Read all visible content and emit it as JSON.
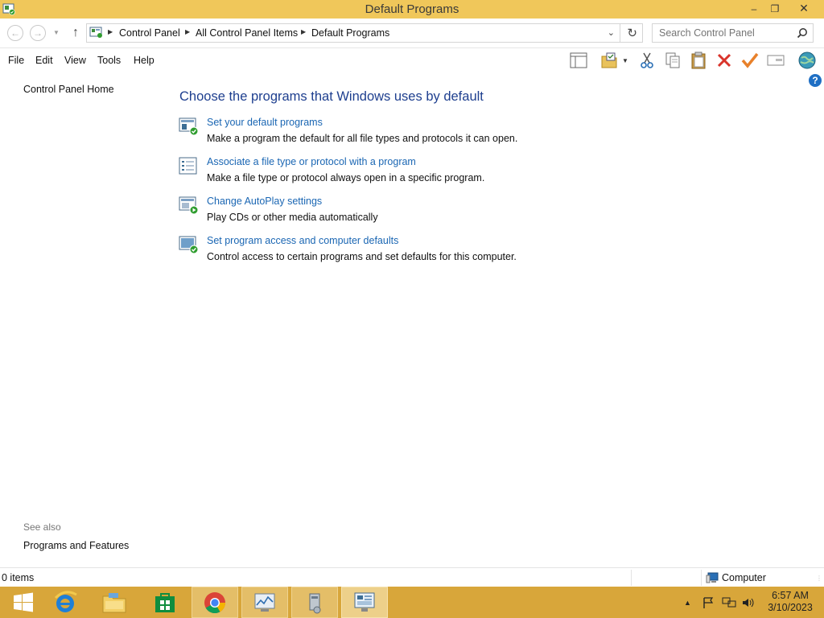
{
  "window": {
    "title": "Default Programs",
    "minimize": "–",
    "restore": "❐",
    "close": "✕"
  },
  "address_bar": {
    "breadcrumbs": [
      "Control Panel",
      "All Control Panel Items",
      "Default Programs"
    ],
    "search_placeholder": "Search Control Panel"
  },
  "menu": [
    "File",
    "Edit",
    "View",
    "Tools",
    "Help"
  ],
  "toolbar": [
    "layout-icon",
    "folder-options-icon",
    "cut-icon",
    "copy-icon",
    "paste-icon",
    "delete-icon",
    "checkmark-icon",
    "properties-icon",
    "globe-icon"
  ],
  "left_pane": {
    "home_link": "Control Panel Home",
    "see_also_label": "See also",
    "see_also_links": [
      "Programs and Features"
    ]
  },
  "main": {
    "heading": "Choose the programs that Windows uses by default",
    "tasks": [
      {
        "icon": "default-programs-icon",
        "link": "Set your default programs",
        "description": "Make a program the default for all file types and protocols it can open."
      },
      {
        "icon": "file-association-icon",
        "link": "Associate a file type or protocol with a program",
        "description": "Make a file type or protocol always open in a specific program."
      },
      {
        "icon": "autoplay-icon",
        "link": "Change AutoPlay settings",
        "description": "Play CDs or other media automatically"
      },
      {
        "icon": "program-access-icon",
        "link": "Set program access and computer defaults",
        "description": "Control access to certain programs and set defaults for this computer."
      }
    ]
  },
  "status_bar": {
    "items_count": "0 items",
    "location": "Computer"
  },
  "taskbar": {
    "apps": [
      "start-button",
      "internet-explorer-icon",
      "file-explorer-icon",
      "store-icon",
      "chrome-icon",
      "performance-monitor-icon",
      "system-tool-icon",
      "control-panel-icon"
    ],
    "clock_time": "6:57 AM",
    "clock_date": "3/10/2023"
  },
  "colors": {
    "title_bar": "#f0c75a",
    "taskbar": "#d8a63a",
    "heading": "#1e3f8f",
    "link": "#1a66b3"
  }
}
